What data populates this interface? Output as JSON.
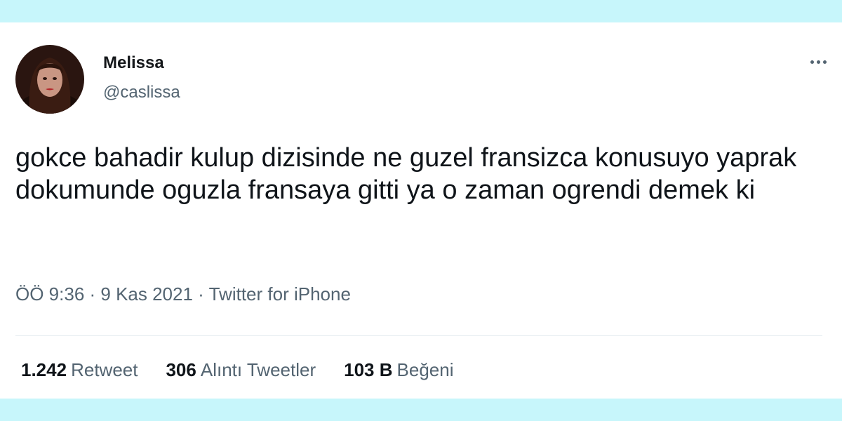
{
  "tweet": {
    "author_name": "Melissa",
    "author_handle": "@caslissa",
    "text": "gokce bahadir kulup dizisinde ne guzel fransizca konusuyo yaprak dokumunde oguzla fransaya gitti ya o zaman ogrendi demek ki",
    "time": "ÖÖ 9:36",
    "separator": " · ",
    "date": "9 Kas 2021",
    "source": "Twitter for iPhone",
    "more_icon": "more-horizontal-icon"
  },
  "stats": {
    "retweets": {
      "value": "1.242",
      "label": "Retweet"
    },
    "quotes": {
      "value": "306",
      "label": "Alıntı Tweetler"
    },
    "likes": {
      "value": "103 B",
      "label": "Beğeni"
    }
  },
  "colors": {
    "frame": "#c7f6fb",
    "card": "#ffffff",
    "text_primary": "#0f1419",
    "text_secondary": "#536471"
  }
}
